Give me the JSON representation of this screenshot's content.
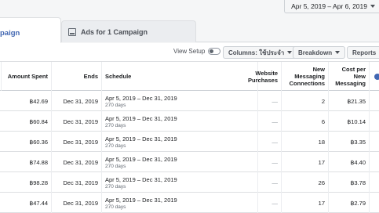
{
  "header": {
    "date_range": "Apr 5, 2019 – Apr 6, 2019"
  },
  "tabs": {
    "campaigns_label": "paign",
    "ads_label": "Ads for 1 Campaign"
  },
  "toolbar": {
    "view_setup_label": "View Setup",
    "columns_label": "Columns: ใช้ประจำ",
    "breakdown_label": "Breakdown",
    "reports_label": "Reports"
  },
  "table": {
    "columns": {
      "amount_spent": "Amount Spent",
      "ends": "Ends",
      "schedule": "Schedule",
      "website_purchases_line1": "Website",
      "website_purchases_line2": "Purchases",
      "new_messaging_line1": "New",
      "new_messaging_line2": "Messaging",
      "new_messaging_line3": "Connections",
      "cost_per_line1": "Cost per",
      "cost_per_line2": "New",
      "cost_per_line3": "Messaging"
    },
    "rows": [
      {
        "amount": "฿42.69",
        "ends": "Dec 31, 2019",
        "schedule": "Apr 5, 2019 – Dec 31, 2019",
        "days": "270 days",
        "purchases": "—",
        "messaging": "2",
        "cost": "฿21.35"
      },
      {
        "amount": "฿60.84",
        "ends": "Dec 31, 2019",
        "schedule": "Apr 5, 2019 – Dec 31, 2019",
        "days": "270 days",
        "purchases": "—",
        "messaging": "6",
        "cost": "฿10.14"
      },
      {
        "amount": "฿60.36",
        "ends": "Dec 31, 2019",
        "schedule": "Apr 5, 2019 – Dec 31, 2019",
        "days": "270 days",
        "purchases": "—",
        "messaging": "18",
        "cost": "฿3.35"
      },
      {
        "amount": "฿74.88",
        "ends": "Dec 31, 2019",
        "schedule": "Apr 5, 2019 – Dec 31, 2019",
        "days": "270 days",
        "purchases": "—",
        "messaging": "17",
        "cost": "฿4.40"
      },
      {
        "amount": "฿98.28",
        "ends": "Dec 31, 2019",
        "schedule": "Apr 5, 2019 – Dec 31, 2019",
        "days": "270 days",
        "purchases": "—",
        "messaging": "26",
        "cost": "฿3.78"
      },
      {
        "amount": "฿47.44",
        "ends": "Dec 31, 2019",
        "schedule": "Apr 5, 2019 – Dec 31, 2019",
        "days": "270 days",
        "purchases": "—",
        "messaging": "17",
        "cost": "฿2.79"
      }
    ]
  }
}
